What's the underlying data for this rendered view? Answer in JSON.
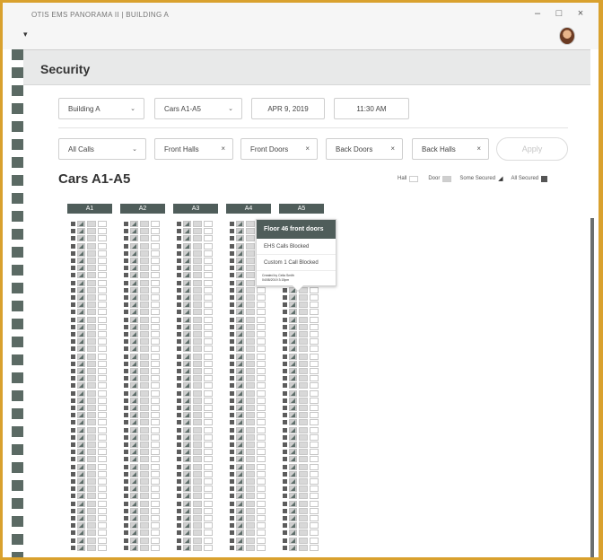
{
  "window": {
    "title": "OTIS EMS PANORAMA II | BUILDING A",
    "menu_caret": "▾",
    "minimize": "–",
    "maximize": "□",
    "close": "×"
  },
  "page": {
    "title": "Security"
  },
  "filters": {
    "building": "Building A",
    "cars": "Cars A1-A5",
    "date": "APR 9, 2019",
    "time": "11:30 AM",
    "calls": "All Calls",
    "chips": [
      {
        "label": "Front Halls",
        "remove": "×"
      },
      {
        "label": "Front Doors",
        "remove": "×"
      },
      {
        "label": "Back Doors",
        "remove": "×"
      },
      {
        "label": "Back Halls",
        "remove": "×"
      }
    ],
    "apply": "Apply"
  },
  "grid": {
    "title": "Cars A1-A5",
    "legend": {
      "hall": "Hall",
      "door": "Door",
      "some_secured": "Some Secured",
      "all_secured": "All Secured"
    },
    "cars": [
      "A1",
      "A2",
      "A3",
      "A4",
      "A5"
    ]
  },
  "tooltip": {
    "title": "Floor 46 front doors",
    "items": [
      "EHS Calls Blocked",
      "Custom 1 Call Blocked"
    ],
    "meta_line1": "Created by Celia Smith",
    "meta_line2": "04/08/2019 3:15pm"
  },
  "colors": {
    "frame_border": "#d9a12e",
    "car_header": "#4f5d5a",
    "secured_dark": "#5c5c5c",
    "door_gray": "#cfcfcf"
  }
}
